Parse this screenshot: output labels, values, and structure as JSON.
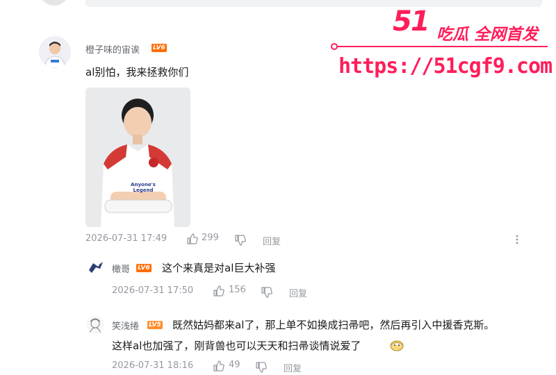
{
  "watermark": {
    "brand_number": "51",
    "slogan": "吃瓜 全网首发",
    "url": "https://51cgf9.com"
  },
  "comment": {
    "username": "橙子味的宙诶",
    "level": "LV6",
    "text": "al别怕，我来拯救你们",
    "photo_jersey_text": "Anyone's Legend",
    "time": "2026-07-31 17:49",
    "likes": "299",
    "reply_label": "回复",
    "more_icon": "more-vertical-icon"
  },
  "replies": [
    {
      "username": "橄哥",
      "level": "LV6",
      "text": "这个来真是对al巨大补强",
      "time": "2026-07-31 17:50",
      "likes": "156",
      "reply_label": "回复"
    },
    {
      "username": "笑浅绻",
      "level": "LV5",
      "text_line1": "既然姑妈都来al了，那上单不如换成扫帚吧，然后再引入中援香克斯。",
      "text_line2": "这样al也加强了，刚背兽也可以天天和扫帚谈情说爱了",
      "emoji": "dog-head-emoji",
      "time": "2026-07-31 18:16",
      "likes": "49",
      "reply_label": "回复"
    }
  ],
  "colors": {
    "level6": "#ff6c00",
    "level5": "#ff8d2c",
    "watermark": "#ff1e5a",
    "meta": "#9499a0"
  }
}
